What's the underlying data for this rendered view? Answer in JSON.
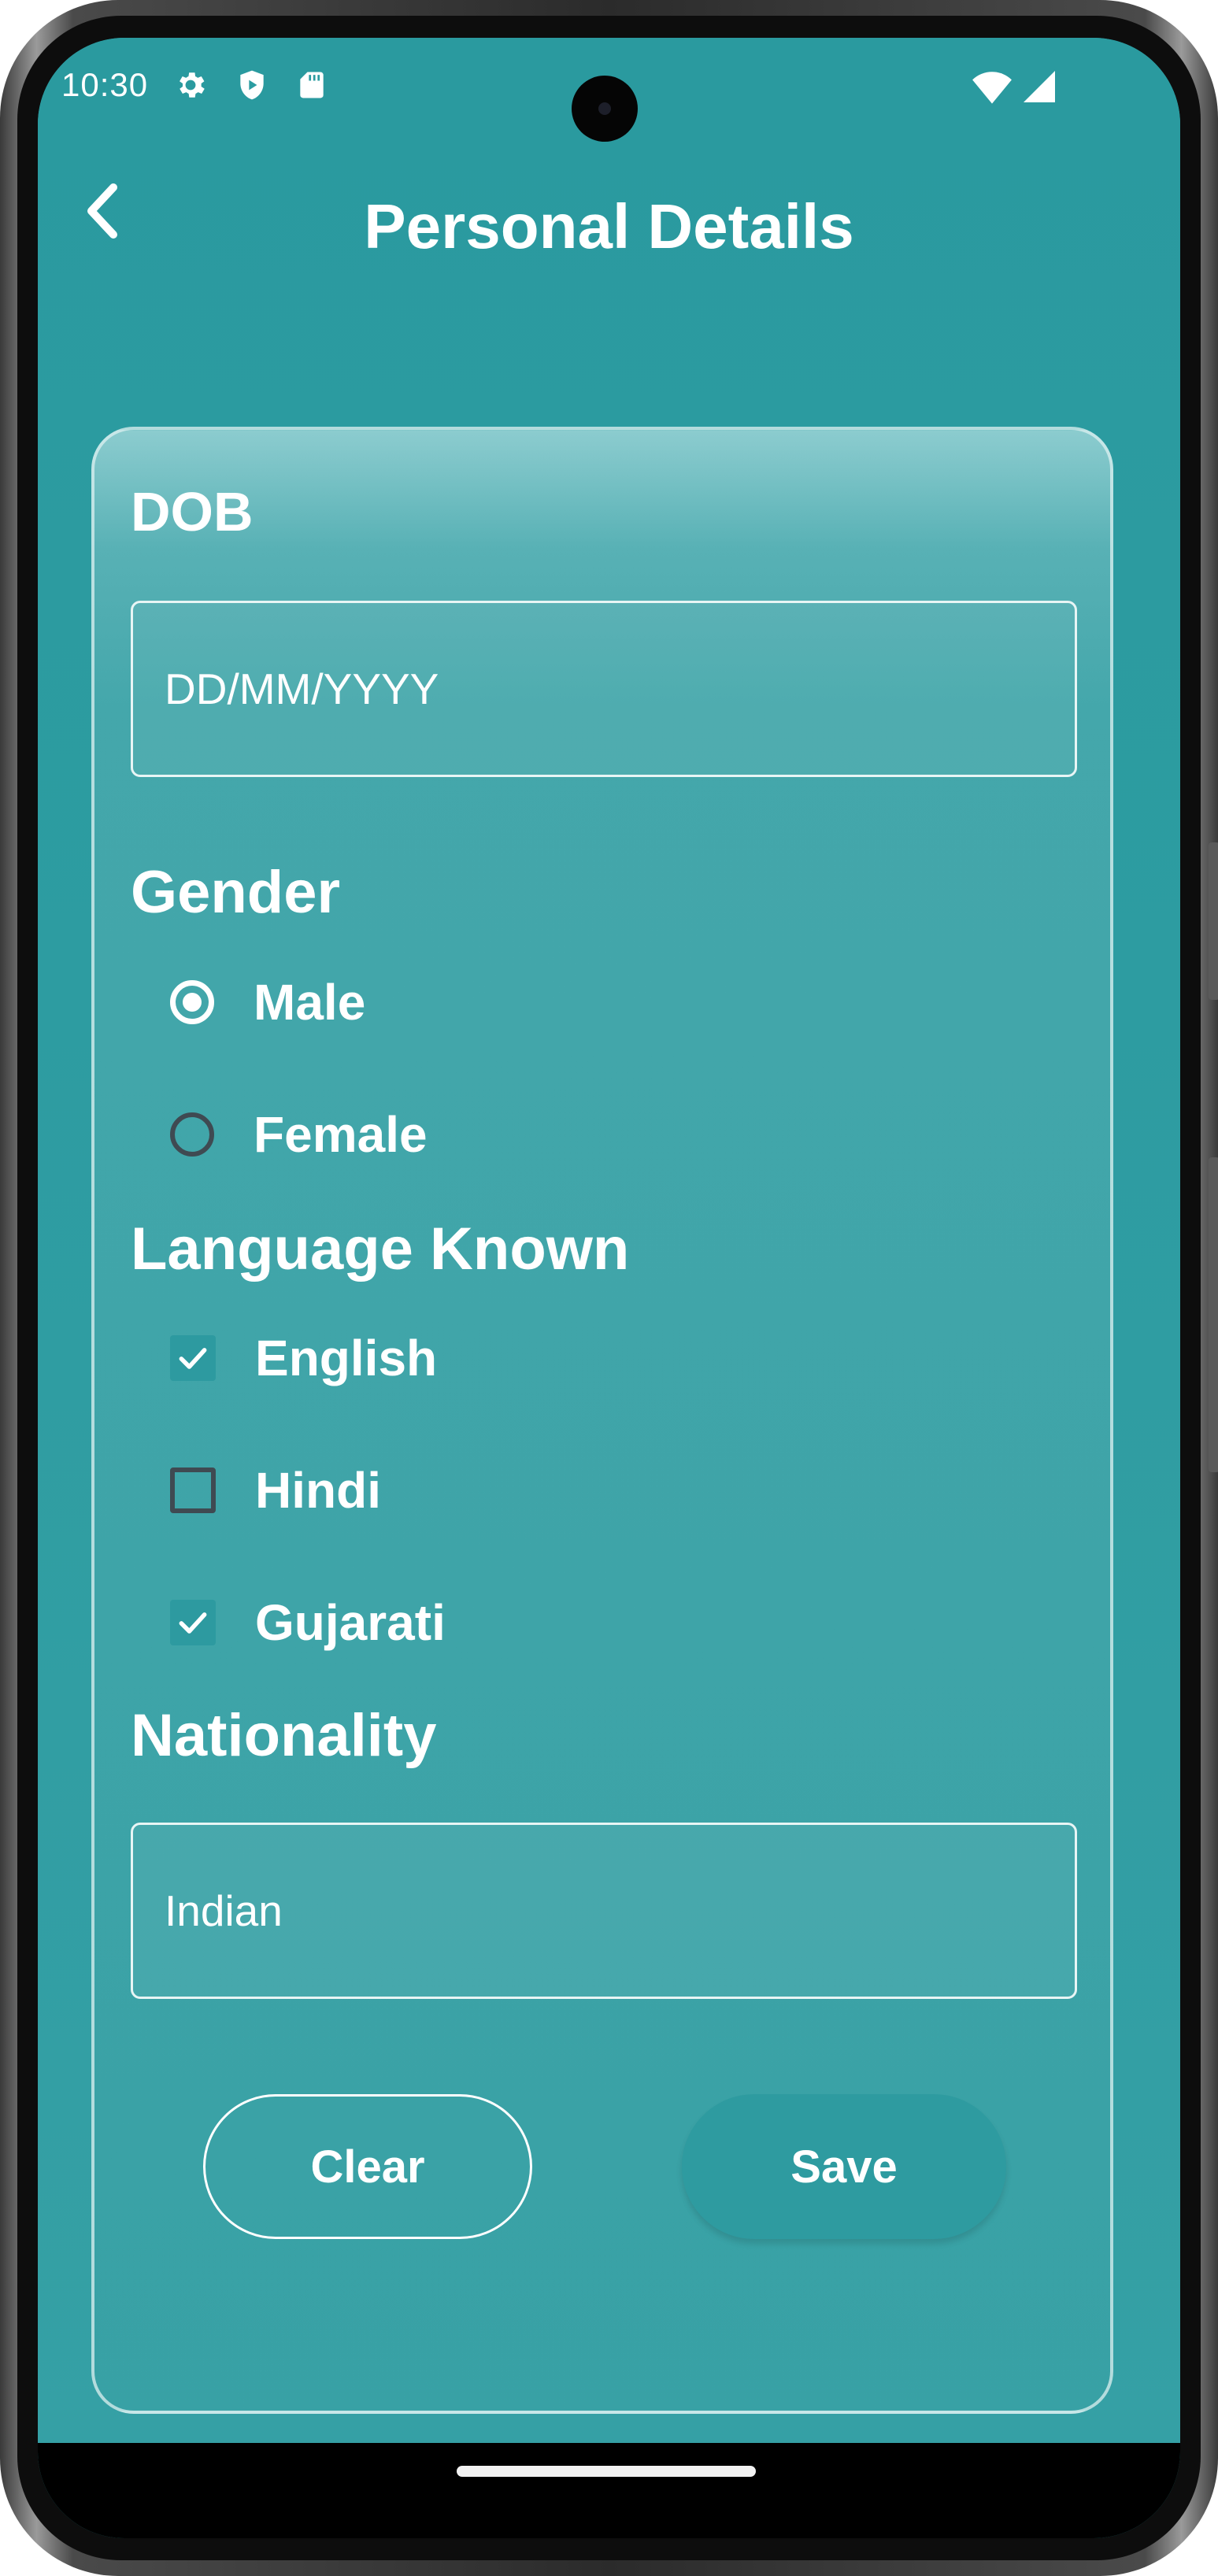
{
  "status_bar": {
    "time": "10:30",
    "left_icons": [
      "gear-icon",
      "shield-play-icon",
      "sd-card-icon"
    ],
    "right_icons": [
      "wifi-icon",
      "cell-signal-icon"
    ]
  },
  "toolbar": {
    "back_icon": "chevron-left-icon",
    "title": "Personal Details"
  },
  "form": {
    "dob": {
      "label": "DOB",
      "placeholder": "DD/MM/YYYY"
    },
    "gender": {
      "label": "Gender",
      "options": [
        {
          "label": "Male",
          "selected": true
        },
        {
          "label": "Female",
          "selected": false
        }
      ]
    },
    "languages": {
      "label": "Language Known",
      "options": [
        {
          "label": "English",
          "checked": true
        },
        {
          "label": "Hindi",
          "checked": false
        },
        {
          "label": "Gujarati",
          "checked": true
        }
      ]
    },
    "nationality": {
      "label": "Nationality",
      "value": "Indian"
    },
    "buttons": {
      "clear": "Clear",
      "save": "Save"
    }
  },
  "colors": {
    "background": "#2b9ca1",
    "card_border": "#dcf0f0",
    "save_button": "#2e9ba0",
    "unchecked_control": "#3f4a52"
  }
}
